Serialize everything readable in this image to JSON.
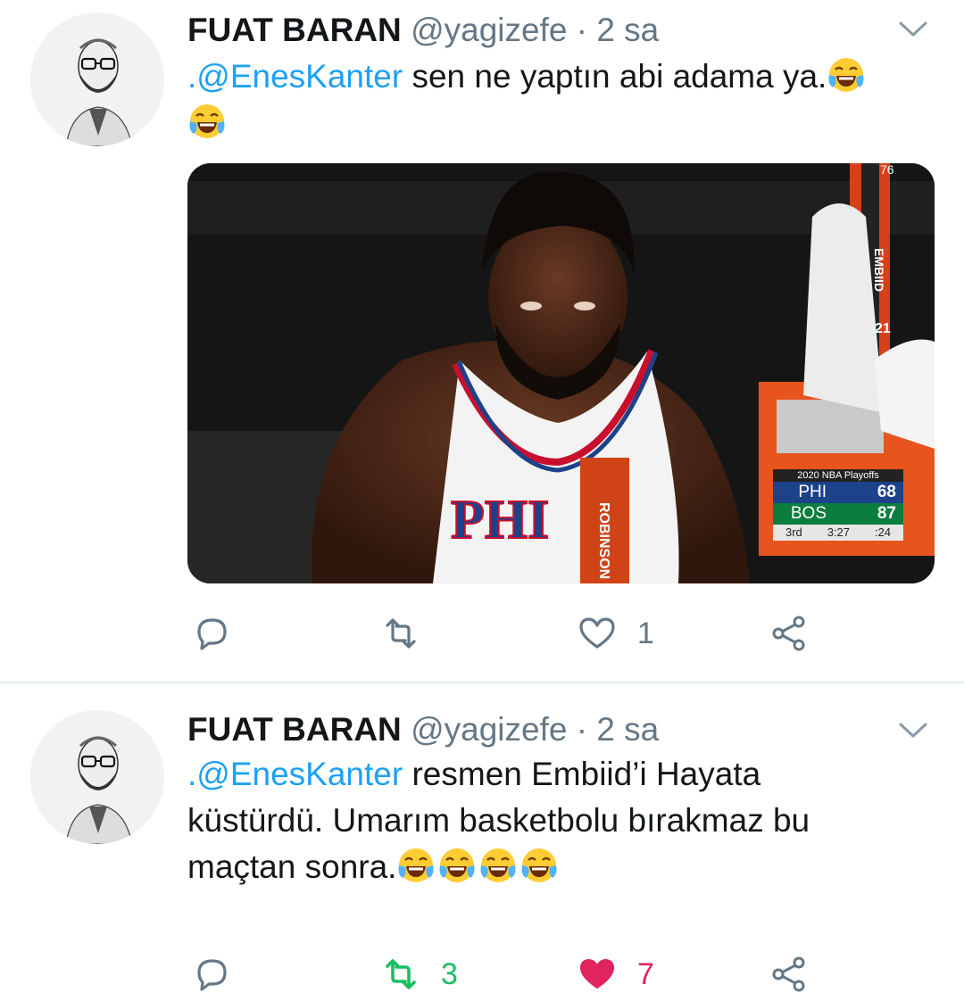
{
  "colors": {
    "link": "#1da1f2",
    "text": "#14171a",
    "meta": "#657786",
    "retweet_active": "#17bf63",
    "like_active": "#e0245e",
    "divider": "#e6ecf0"
  },
  "tweets": [
    {
      "author_name": "FUAT BARAN",
      "handle": "@yagizefe",
      "time": "· 2 sa",
      "mention": ".@EnesKanter",
      "body": " sen ne yaptın abi adama ya.",
      "emoji_count": 2,
      "media": {
        "scoreboard": {
          "title": "2020 NBA Playoffs",
          "team1": "PHI",
          "score1": "68",
          "team2": "BOS",
          "score2": "87",
          "period": "3rd",
          "clock": "3:27",
          "shot_clock": ":24"
        },
        "jersey_text": "PHI",
        "towel_text": "ROBINSON",
        "chair_text": "EMBIID",
        "chair_number": "21",
        "logo_text": "76"
      },
      "actions": {
        "reply_count": "",
        "retweet_count": "",
        "like_count": "1",
        "retweeted": false,
        "liked": false
      }
    },
    {
      "author_name": "FUAT BARAN",
      "handle": "@yagizefe",
      "time": "· 2 sa",
      "mention": ".@EnesKanter",
      "body_line1": " resmen Embiid’i Hayata",
      "body_line2": "küstürdü. Umarım basketbolu bırakmaz bu",
      "body_line3": "maçtan sonra.",
      "emoji_count": 4,
      "actions": {
        "reply_count": "",
        "retweet_count": "3",
        "like_count": "7",
        "retweeted": true,
        "liked": true
      }
    }
  ]
}
